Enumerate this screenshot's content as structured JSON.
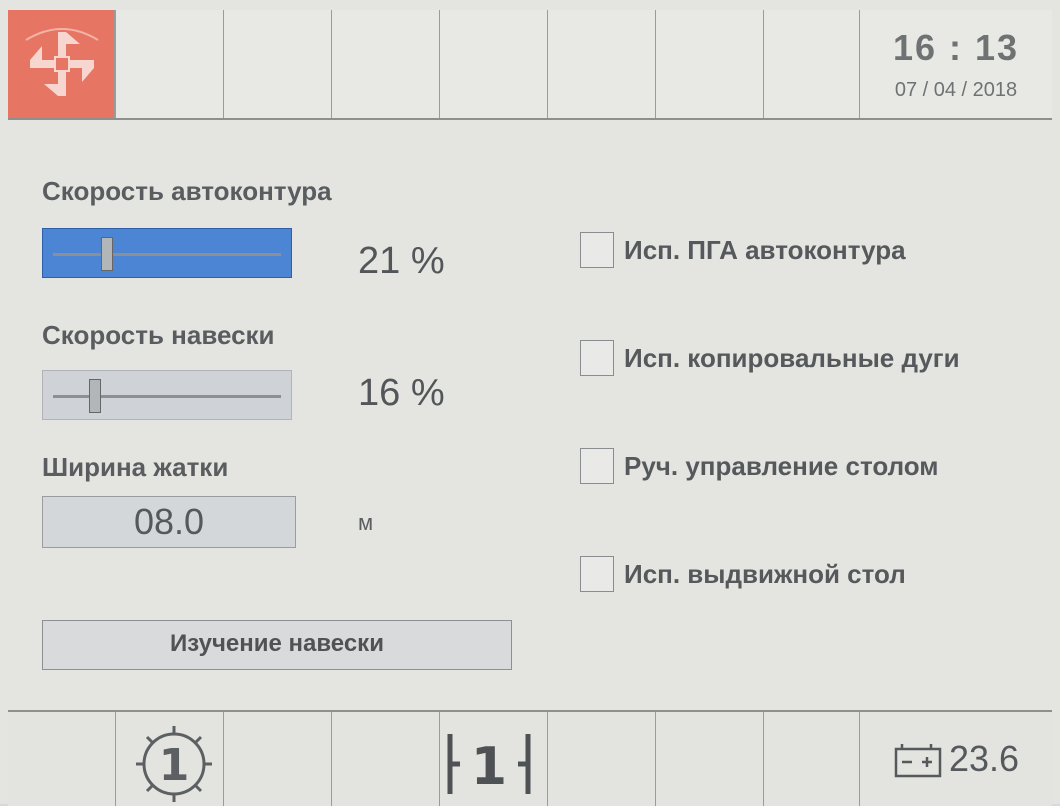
{
  "header": {
    "time": "16 : 13",
    "date": "07 / 04 / 2018",
    "logo_icon": "pinwheel-logo-icon"
  },
  "controls": {
    "autocontour_speed": {
      "label": "Скорость автоконтура",
      "value": "21 %",
      "level": 0.21,
      "active": true
    },
    "hitch_speed": {
      "label": "Скорость навески",
      "value": "16 %",
      "level": 0.16,
      "active": false
    },
    "header_width": {
      "label": "Ширина жатки",
      "value": "08.0",
      "unit": "м"
    },
    "learn_button": "Изучение навески"
  },
  "options": [
    {
      "label": "Исп. ПГА автоконтура",
      "checked": false
    },
    {
      "label": "Исп. копировальные дуги",
      "checked": false
    },
    {
      "label": "Руч. управление столом",
      "checked": false
    },
    {
      "label": "Исп. выдвижной стол",
      "checked": false
    }
  ],
  "footer": {
    "gear_icon": "gear-1-icon",
    "split_icon": "split-1-icon",
    "split_text": "1",
    "gear_text": "1",
    "battery_voltage": "23.6"
  },
  "colors": {
    "logo_bg": "#e77563",
    "slider_active": "#4d85d5",
    "slider_inactive": "#cfd3d8"
  }
}
